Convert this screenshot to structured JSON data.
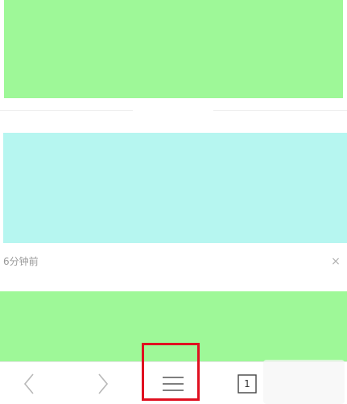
{
  "colors": {
    "green_block": "#9ef898",
    "cyan_block": "#b6f6f0",
    "highlight": "#e01020"
  },
  "feed": {
    "timestamp": "6分钟前",
    "close_label": "×"
  },
  "toolbar": {
    "back_icon": "chevron-left-icon",
    "forward_icon": "chevron-right-icon",
    "menu_icon": "hamburger-menu-icon",
    "tabs_icon": "tabs-icon",
    "tab_count": "1"
  }
}
